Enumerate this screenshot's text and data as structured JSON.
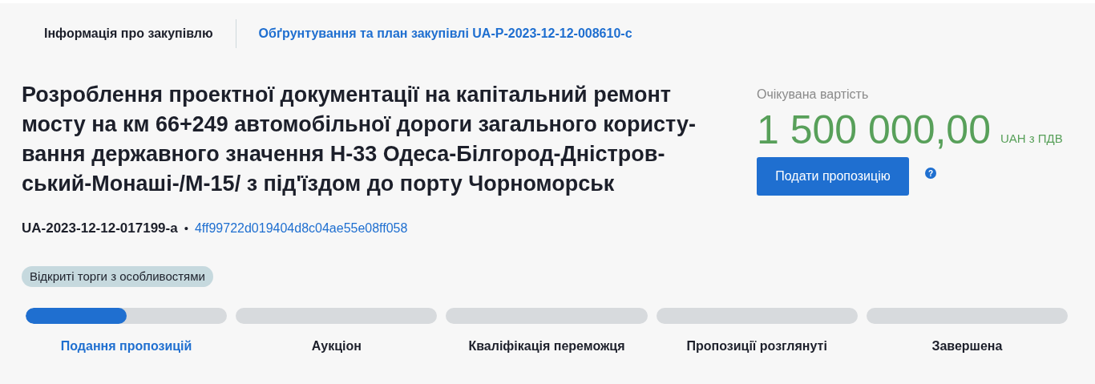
{
  "tabs": [
    {
      "label": "Інформація про закупівлю",
      "selected": true
    },
    {
      "label": "Обґрунтування та план закупівлі UA-P-2023-12-12-008610-c",
      "selected": false
    }
  ],
  "title_lines": [
    "Розроблення проектної документації на капітальний ремонт",
    "мосту на км 66+249 автомобільної дороги загального користу-",
    "вання державного значення Н-33 Одеса-Білгород-Дністров-",
    "ський-Монаші-/М-15/ з під'їздом до порту Чорноморськ"
  ],
  "tender_id": "UA-2023-12-12-017199-a",
  "separator": "•",
  "hash_link": "4ff99722d019404d8c04ae55e08ff058",
  "procedure_tag": "Відкриті торги з особливостями",
  "value": {
    "label": "Очікувана вартість",
    "amount": "1 500 000,00",
    "currency": "UAH з ПДВ"
  },
  "submit_button": "Подати пропозицію",
  "help_icon": "?",
  "stages": [
    {
      "label": "Подання пропозицій",
      "selected": true,
      "level": 0.5
    },
    {
      "label": "Аукціон",
      "selected": false
    },
    {
      "label": "Кваліфікація переможця",
      "selected": false
    },
    {
      "label": "Пропозиції розглянуті",
      "selected": false
    },
    {
      "label": "Завершена",
      "selected": false
    }
  ]
}
